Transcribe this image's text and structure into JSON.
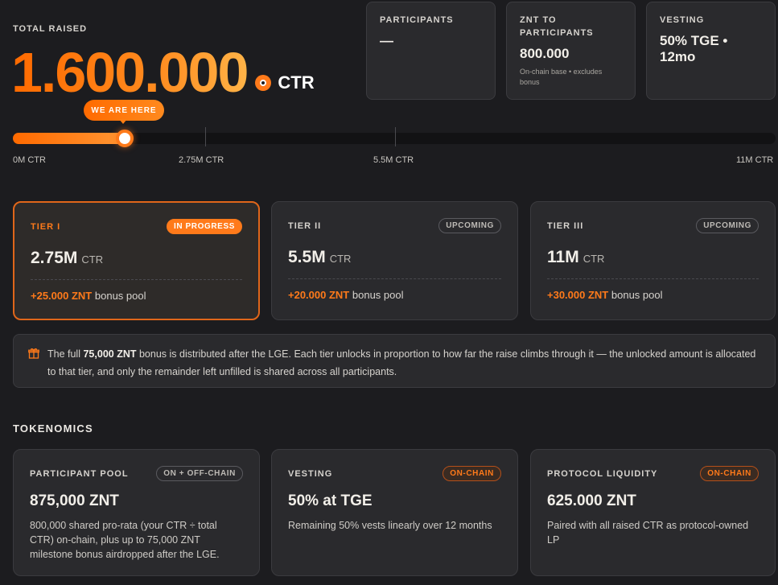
{
  "header": {
    "total_raised_label": "TOTAL RAISED",
    "total_raised_value": "1.600.000",
    "currency": "CTR"
  },
  "stats": [
    {
      "label": "PARTICIPANTS",
      "value": "—",
      "note": ""
    },
    {
      "label": "ZNT TO PARTICIPANTS",
      "value": "800.000",
      "note": "On-chain base • excludes bonus"
    },
    {
      "label": "VESTING",
      "value": "50% TGE • 12mo",
      "note": ""
    }
  ],
  "progress": {
    "marker_label": "WE ARE HERE",
    "raised": 1600000,
    "max": 11000000,
    "ticks": [
      {
        "label": "0M CTR",
        "value": 0
      },
      {
        "label": "2.75M CTR",
        "value": 2750000
      },
      {
        "label": "5.5M CTR",
        "value": 5500000
      },
      {
        "label": "11M CTR",
        "value": 11000000
      }
    ]
  },
  "tiers": [
    {
      "name": "TIER I",
      "status": "IN PROGRESS",
      "amount": "2.75M",
      "unit": "CTR",
      "bonus": "+25.000 ZNT",
      "bonus_suffix": "bonus pool"
    },
    {
      "name": "TIER II",
      "status": "UPCOMING",
      "amount": "5.5M",
      "unit": "CTR",
      "bonus": "+20.000 ZNT",
      "bonus_suffix": "bonus pool"
    },
    {
      "name": "TIER III",
      "status": "UPCOMING",
      "amount": "11M",
      "unit": "CTR",
      "bonus": "+30.000 ZNT",
      "bonus_suffix": "bonus pool"
    }
  ],
  "info": {
    "prefix": "The full",
    "highlight": "75,000 ZNT",
    "text": "bonus is distributed after the LGE. Each tier unlocks in proportion to how far the raise climbs through it — the unlocked amount is allocated to that tier, and only the remainder left unfilled is shared across all participants."
  },
  "tokenomics": {
    "title": "TOKENOMICS",
    "cards": [
      {
        "label": "PARTICIPANT POOL",
        "badge": "ON + OFF-CHAIN",
        "value": "875,000 ZNT",
        "desc": "800,000 shared pro-rata (your CTR ÷ total CTR) on-chain, plus up to 75,000 ZNT milestone bonus airdropped after the LGE."
      },
      {
        "label": "VESTING",
        "badge": "ON-CHAIN",
        "value": "50% at TGE",
        "desc": "Remaining 50% vests linearly over 12 months"
      },
      {
        "label": "PROTOCOL LIQUIDITY",
        "badge": "ON-CHAIN",
        "value": "625.000 ZNT",
        "desc": "Paired with all raised CTR as protocol-owned LP"
      }
    ]
  },
  "colors": {
    "accent": "#ff7a1a",
    "background": "#1c1c1f",
    "card": "#2a2a2d"
  }
}
